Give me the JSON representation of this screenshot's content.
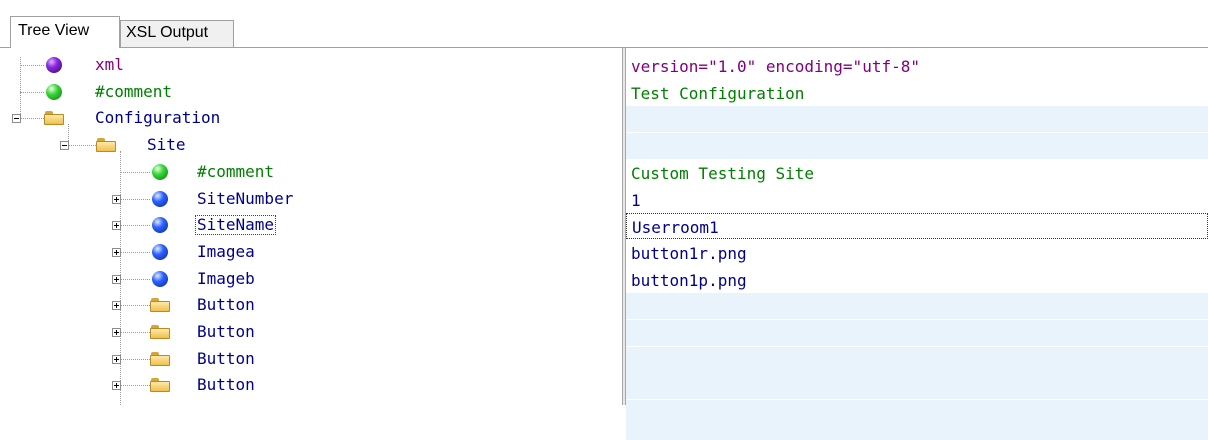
{
  "tabs": [
    {
      "label": "Tree View",
      "active": true
    },
    {
      "label": "XSL Output",
      "active": false
    }
  ],
  "colors": {
    "xml": "#800080",
    "comment": "#008000",
    "element": "#00008b",
    "value_row_shade": "#e8f3fc"
  },
  "tree": [
    {
      "label": "xml",
      "icon": "purple-sphere-icon",
      "kind": "xml",
      "expander": "none"
    },
    {
      "label": "#comment",
      "icon": "green-sphere-icon",
      "kind": "comment",
      "expander": "none"
    },
    {
      "label": "Configuration",
      "icon": "folder-icon",
      "kind": "element",
      "expander": "minus"
    },
    {
      "label": "Site",
      "icon": "folder-icon",
      "kind": "element",
      "expander": "minus"
    },
    {
      "label": "#comment",
      "icon": "green-sphere-icon",
      "kind": "comment",
      "expander": "none"
    },
    {
      "label": "SiteNumber",
      "icon": "blue-sphere-icon",
      "kind": "element",
      "expander": "plus"
    },
    {
      "label": "SiteName",
      "icon": "blue-sphere-icon",
      "kind": "element",
      "expander": "plus",
      "selected": true
    },
    {
      "label": "Imagea",
      "icon": "blue-sphere-icon",
      "kind": "element",
      "expander": "plus"
    },
    {
      "label": "Imageb",
      "icon": "blue-sphere-icon",
      "kind": "element",
      "expander": "plus"
    },
    {
      "label": "Button",
      "icon": "folder-icon",
      "kind": "element",
      "expander": "plus"
    },
    {
      "label": "Button",
      "icon": "folder-icon",
      "kind": "element",
      "expander": "plus"
    },
    {
      "label": "Button",
      "icon": "folder-icon",
      "kind": "element",
      "expander": "plus"
    },
    {
      "label": "Button",
      "icon": "folder-icon",
      "kind": "element",
      "expander": "plus"
    }
  ],
  "values": [
    {
      "text": "version=\"1.0\" encoding=\"utf-8\"",
      "kind": "xml",
      "shaded": false
    },
    {
      "text": "Test Configuration",
      "kind": "comment",
      "shaded": false
    },
    {
      "text": "",
      "kind": "element",
      "shaded": true
    },
    {
      "text": "",
      "kind": "element",
      "shaded": true
    },
    {
      "text": "Custom Testing Site",
      "kind": "comment",
      "shaded": false
    },
    {
      "text": "1",
      "kind": "element",
      "shaded": false
    },
    {
      "text": "Userroom1",
      "kind": "element",
      "shaded": false,
      "selected": true
    },
    {
      "text": "button1r.png",
      "kind": "element",
      "shaded": false
    },
    {
      "text": "button1p.png",
      "kind": "element",
      "shaded": false
    },
    {
      "text": "",
      "kind": "element",
      "shaded": true
    },
    {
      "text": "",
      "kind": "element",
      "shaded": true
    },
    {
      "text": "",
      "kind": "element",
      "shaded": true
    },
    {
      "text": "",
      "kind": "element",
      "shaded": true
    }
  ]
}
